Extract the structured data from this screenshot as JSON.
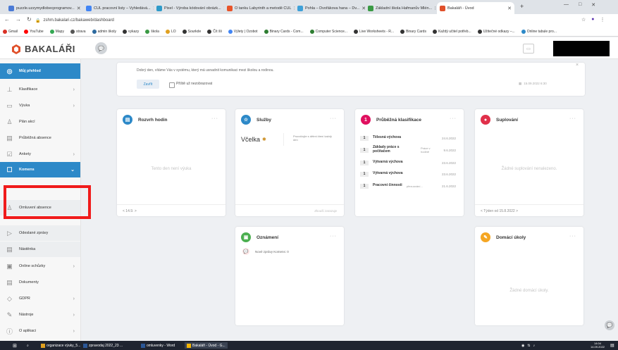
{
  "browser": {
    "tabs": [
      {
        "label": "puzzle.uzzymydlobecprogramov...",
        "color": "#4a7ad6"
      },
      {
        "label": "CUL pracovní listy – Vyhledává...",
        "color": "#4285f4"
      },
      {
        "label": "Pixel - Výroba kódování obrázk...",
        "color": "#2e9ac9"
      },
      {
        "label": "O tanku Labyrinth a metodě CUL",
        "color": "#e8542a"
      },
      {
        "label": "Pohla – Dvořákova hana – Dv...",
        "color": "#3ea0d8"
      },
      {
        "label": "Základní škola Hafmanův Mlén...",
        "color": "#3a9a44"
      },
      {
        "label": "Bakaláři - Úvod",
        "color": "#e0502a"
      }
    ],
    "url": "zshm.bakalari.cz/bakaweb/dashboard",
    "bookmarks": [
      "Gmail",
      "YouTube",
      "Mapy",
      "strava",
      "admin školy",
      "vykazy",
      "škola",
      "LO",
      "Sourkde",
      "Čít šli",
      "Výlety | Ozobot",
      "Binary Cards - Com...",
      "Computer Science...",
      "Live Worksheets - R...",
      "Binary Cards",
      "Každý učitel potřeb...",
      "Užitečné odkazy –...",
      "Online tabule pro..."
    ]
  },
  "app": {
    "logo": "BAKALÁŘI"
  },
  "sidebar": {
    "items": [
      {
        "label": "Můj přehled",
        "icon": "dashboard-icon",
        "chevron": ""
      },
      {
        "label": "Klasifikace",
        "icon": "grade-icon",
        "chevron": ">"
      },
      {
        "label": "Výuka",
        "icon": "book-icon",
        "chevron": ">"
      },
      {
        "label": "Plán akcí",
        "icon": "calendar-icon",
        "chevron": ""
      },
      {
        "label": "Průběžná absence",
        "icon": "absence-icon",
        "chevron": ""
      },
      {
        "label": "Ankety",
        "icon": "poll-icon",
        "chevron": ">"
      },
      {
        "label": "Komens",
        "icon": "chat-icon",
        "chevron": "v"
      },
      {
        "label": "Omluvení absence",
        "icon": "person-icon",
        "chevron": ""
      },
      {
        "label": "Odeslané zprávy",
        "icon": "send-icon",
        "chevron": ""
      },
      {
        "label": "Nástěnka",
        "icon": "board-icon",
        "chevron": ""
      },
      {
        "label": "Online schůzky",
        "icon": "video-icon",
        "chevron": ">"
      },
      {
        "label": "Dokumenty",
        "icon": "document-icon",
        "chevron": ""
      },
      {
        "label": "GDPR",
        "icon": "shield-icon",
        "chevron": ">"
      },
      {
        "label": "Nástroje",
        "icon": "tools-icon",
        "chevron": ">"
      },
      {
        "label": "O aplikaci",
        "icon": "info-icon",
        "chevron": ">"
      }
    ]
  },
  "banner": {
    "text": "Dobrý den, vítáme Vás v systému, který má usnadnit komunikaci mezi školou a rodinou.",
    "close_label": "Zavřít",
    "checkbox_label": "Příště už nezobrazovat",
    "timestamp": "15.09.2022 6:30"
  },
  "cards": {
    "rozvrh": {
      "title": "Rozvrh hodin",
      "empty": "Tento den není výuka",
      "nav": "< 14.9. >"
    },
    "sluzby": {
      "title": "Služby",
      "item_title": "Včelka",
      "item_desc": "Procvičujte s dětmi čtení každý den",
      "footer": "Zkouší zarazuje"
    },
    "klasifikace": {
      "title": "Průběžná klasifikace",
      "grades": [
        {
          "grade": "1",
          "subject": "Tělesná výchova",
          "sub": "",
          "date": "24.6.2022"
        },
        {
          "grade": "1",
          "subject": "Základy práce s počítačem",
          "sub": "Práce v hodině",
          "date": "9.6.2022"
        },
        {
          "grade": "1",
          "subject": "Výtvarná výchova",
          "sub": "",
          "date": "23.6.2022"
        },
        {
          "grade": "1",
          "subject": "Výtvarná výchova",
          "sub": "",
          "date": "23.6.2022"
        },
        {
          "grade": "1",
          "subject": "Pracovní činnosti",
          "sub": "přezuování...",
          "date": "21.6.2022"
        }
      ]
    },
    "suplovani": {
      "title": "Suplování",
      "empty": "Žádné suplování nenalezeno.",
      "nav": "< Týden od 15.8.2022 >"
    },
    "oznameni": {
      "title": "Oznámení",
      "item": "Nové zprávy Komens: 0"
    },
    "ukoly": {
      "title": "Domácí úkoly",
      "empty": "Žádné domácí úkoly."
    }
  },
  "taskbar": {
    "items": [
      "organizace výuky_5...",
      "zpravodaj 2022_23 ...",
      "omluvenky - Word",
      "Bakaláři - Úvod - G..."
    ],
    "clock_time": "14:04",
    "clock_date": "14.09.2022"
  },
  "colors": {
    "accent": "#2d89c8",
    "red_highlight": "#f01b1b",
    "rozvrh": "#2d89c8",
    "sluzby": "#2d89c8",
    "klasifikace": "#e0105f",
    "suplovani": "#e0304a",
    "oznameni": "#4caf50",
    "ukoly": "#f5a623"
  }
}
